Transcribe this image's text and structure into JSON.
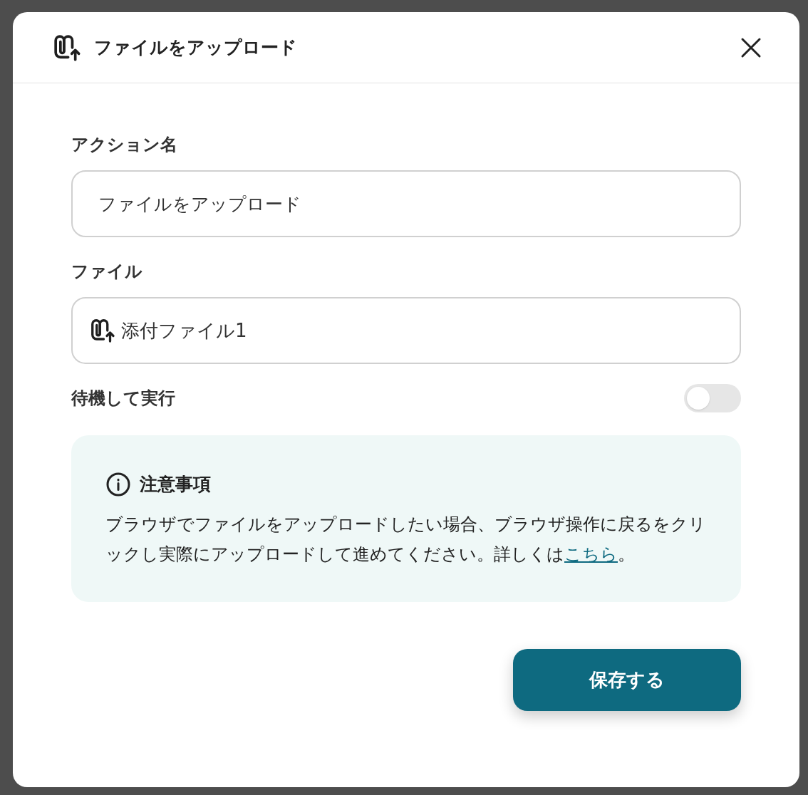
{
  "dialog": {
    "title": "ファイルをアップロード"
  },
  "fields": [
    {
      "kind": "text",
      "label": "アクション名",
      "value": "ファイルをアップロード"
    },
    {
      "kind": "file",
      "label": "ファイル",
      "value": "添付ファイル1"
    }
  ],
  "toggle": {
    "label": "待機して実行",
    "on": false
  },
  "notice": {
    "title": "注意事項",
    "text": "ブラウザでファイルをアップロードしたい場合、ブラウザ操作に戻るをクリックし実際にアップロードして進めてください。詳しくは",
    "link": "こちら",
    "after": "。"
  },
  "save_button": "保存する"
}
